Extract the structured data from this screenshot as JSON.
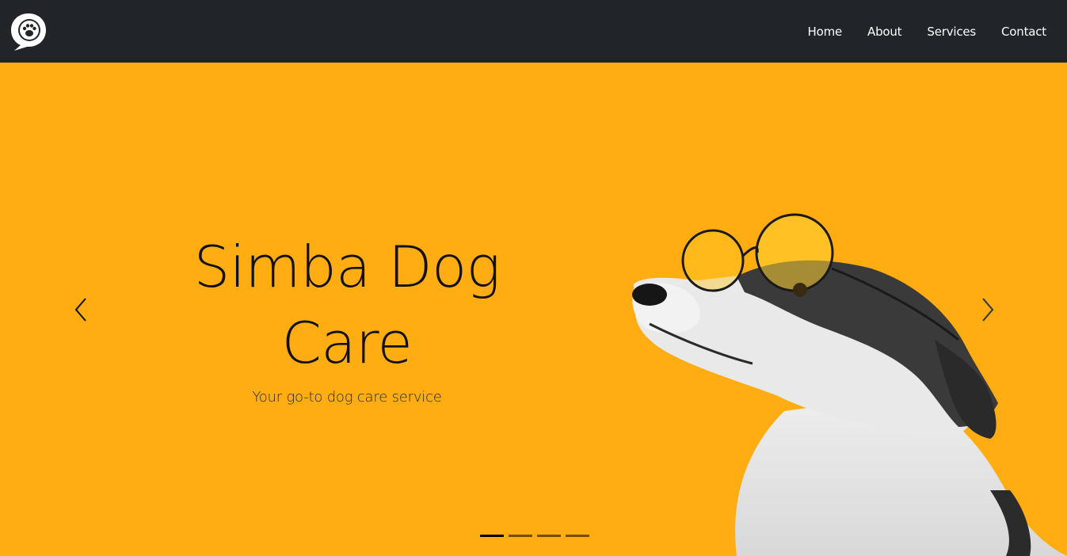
{
  "nav": {
    "logo_icon": "paw-chat-bubble-icon",
    "links": [
      {
        "label": "Home"
      },
      {
        "label": "About"
      },
      {
        "label": "Services"
      },
      {
        "label": "Contact"
      }
    ]
  },
  "hero": {
    "title": "Simba Dog Care",
    "subtitle": "Your go-to dog care service",
    "image_icon": "dog-with-glasses-photo",
    "background_color": "#ffad12",
    "prev_icon": "chevron-left-icon",
    "next_icon": "chevron-right-icon",
    "slides": 4,
    "active_slide": 1
  },
  "colors": {
    "navbar": "#212529",
    "nav_text": "#ffffff",
    "hero_bg": "#ffad12"
  }
}
